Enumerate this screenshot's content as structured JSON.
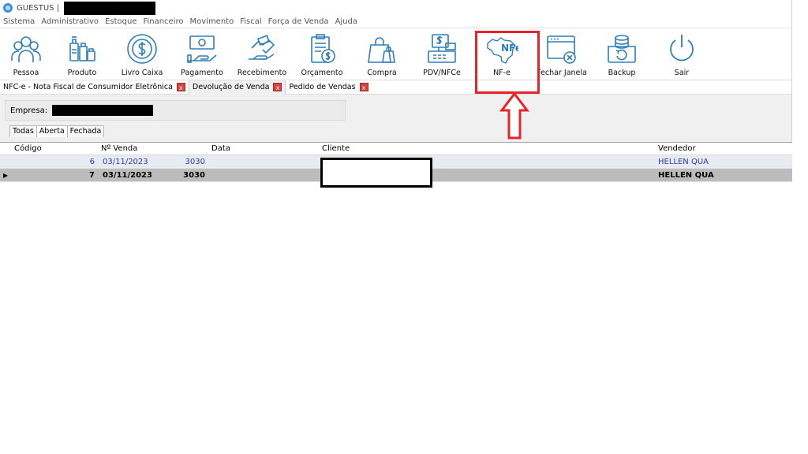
{
  "window": {
    "title": "GUESTUS |"
  },
  "menu": [
    "Sistema",
    "Administrativo",
    "Estoque",
    "Financeiro",
    "Movimento",
    "Fiscal",
    "Força de Venda",
    "Ajuda"
  ],
  "toolbar": {
    "pessoa": "Pessoa",
    "produto": "Produto",
    "livro_caixa": "Livro Caixa",
    "pagamento": "Pagamento",
    "recebimento": "Recebimento",
    "orcamento": "Orçamento",
    "compra": "Compra",
    "pdv_nfce": "PDV/NFCe",
    "nfe": "NF-e",
    "fechar_janela": "Fechar Janela",
    "backup": "Backup",
    "sair": "Sair",
    "nfe_icon_text": "NFe"
  },
  "doc_tabs": [
    {
      "label": "NFC-e - Nota Fiscal de Consumidor Eletrônica"
    },
    {
      "label": "Devolução de Venda"
    },
    {
      "label": "Pedido de Vendas"
    }
  ],
  "tab_close_glyph": "x",
  "empresa": {
    "label": "Empresa:"
  },
  "status_tabs": [
    "Todas",
    "Aberta",
    "Fechada"
  ],
  "grid": {
    "columns": [
      "Código",
      "Nº Venda",
      "Data",
      "Cliente",
      "Vendedor"
    ],
    "rows": [
      {
        "codigo": "6",
        "n_venda": "3030",
        "data": "03/11/2023",
        "vendedor": "HELLEN QUA",
        "indicator": ""
      },
      {
        "codigo": "7",
        "n_venda": "3030",
        "data": "03/11/2023",
        "vendedor": "HELLEN QUA",
        "indicator": "▶"
      }
    ]
  },
  "colors": {
    "highlight": "#e8242a",
    "icon_stroke": "#2e7fb8",
    "selected_row": "#bcbcbc"
  }
}
